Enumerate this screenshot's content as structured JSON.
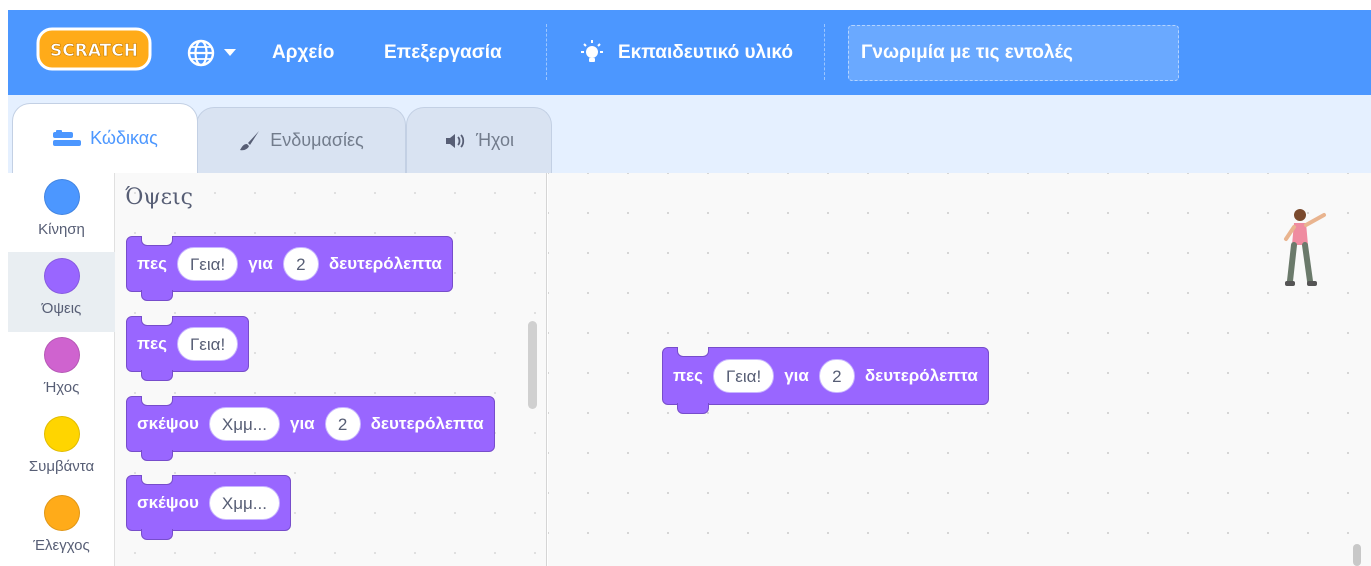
{
  "menubar": {
    "logo_text": "SCRATCH",
    "file_label": "Αρχείο",
    "edit_label": "Επεξεργασία",
    "tutorials_label": "Εκπαιδευτικό υλικό",
    "project_title": "Γνωριμία με τις εντολές"
  },
  "tabs": {
    "code": "Κώδικας",
    "costumes": "Ενδυμασίες",
    "sounds": "Ήχοι"
  },
  "categories": [
    {
      "label": "Κίνηση",
      "color": "#4c97ff"
    },
    {
      "label": "Όψεις",
      "color": "#9966ff"
    },
    {
      "label": "Ήχος",
      "color": "#cf63cf"
    },
    {
      "label": "Συμβάντα",
      "color": "#ffd500"
    },
    {
      "label": "Έλεγχος",
      "color": "#ffab19"
    }
  ],
  "flyout": {
    "title": "Όψεις",
    "blocks": [
      {
        "word1": "πες",
        "text": "Γεια!",
        "word2": "για",
        "number": "2",
        "word3": "δευτερόλεπτα"
      },
      {
        "word1": "πες",
        "text": "Γεια!"
      },
      {
        "word1": "σκέψου",
        "text": "Χμμ...",
        "word2": "για",
        "number": "2",
        "word3": "δευτερόλεπτα"
      },
      {
        "word1": "σκέψου",
        "text": "Χμμ..."
      }
    ]
  },
  "script": {
    "block": {
      "word1": "πες",
      "text": "Γεια!",
      "word2": "για",
      "number": "2",
      "word3": "δευτερόλεπτα"
    }
  },
  "colors": {
    "menubar": "#4c97ff",
    "looks_block": "#9966ff",
    "looks_block_border": "#774dcb"
  }
}
